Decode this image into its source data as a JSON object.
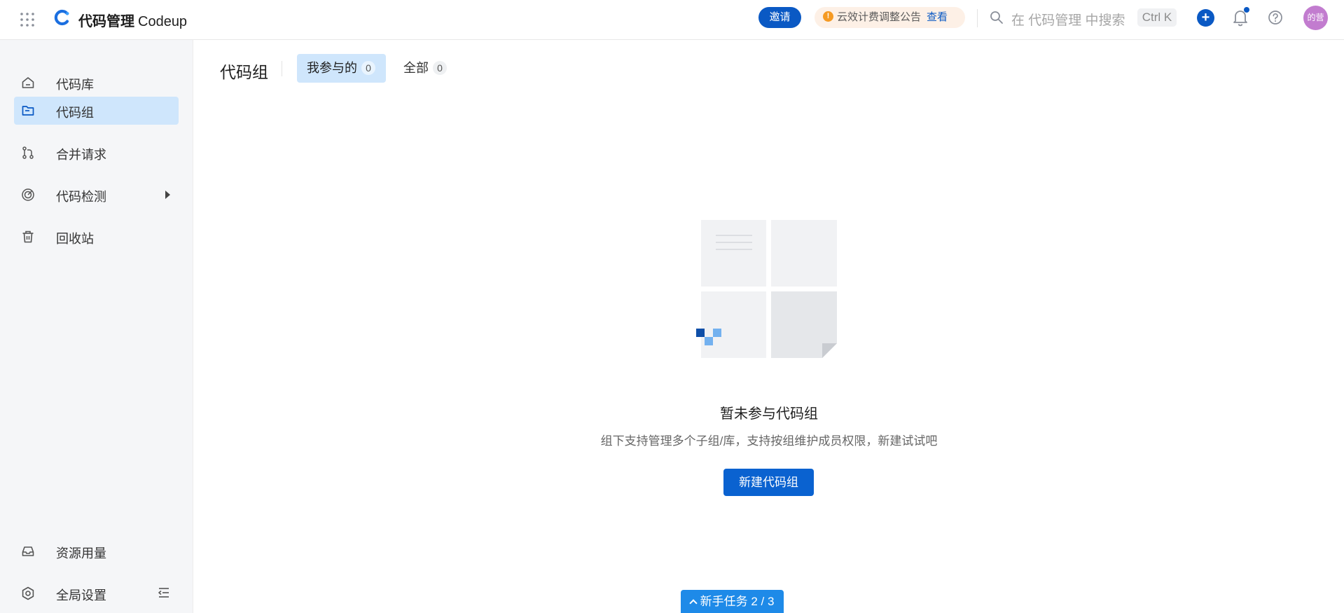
{
  "header": {
    "app_name": "代码管理",
    "app_name_en": "Codeup",
    "invite_label": "邀请",
    "notice_icon_text": "!",
    "notice_text": "云效计费调整公告",
    "notice_link": "查看",
    "search_placeholder": "在 代码管理 中搜索",
    "shortcut": "Ctrl K",
    "create_symbol": "+",
    "avatar_text": "的营"
  },
  "sidebar": {
    "items": [
      {
        "label": "代码库",
        "icon": "home-icon",
        "active": false
      },
      {
        "label": "代码组",
        "icon": "folder-icon",
        "active": true
      },
      {
        "label": "合并请求",
        "icon": "merge-icon",
        "active": false
      },
      {
        "label": "代码检测",
        "icon": "scan-icon",
        "active": false,
        "has_caret": true
      },
      {
        "label": "回收站",
        "icon": "trash-icon",
        "active": false
      }
    ],
    "bottom_items": [
      {
        "label": "资源用量",
        "icon": "inbox-icon"
      },
      {
        "label": "全局设置",
        "icon": "settings-icon"
      }
    ]
  },
  "main": {
    "title": "代码组",
    "tabs": [
      {
        "label": "我参与的",
        "count": "0",
        "active": true
      },
      {
        "label": "全部",
        "count": "0",
        "active": false
      }
    ],
    "empty": {
      "title": "暂未参与代码组",
      "description": "组下支持管理多个子组/库，支持按组维护成员权限，新建试试吧",
      "button": "新建代码组"
    },
    "task_button": "新手任务 2 / 3"
  },
  "colors": {
    "brand": "#0a59c4",
    "active_bg": "#cfe6fc",
    "sidebar_bg": "#f5f6f8",
    "notice_bg": "#fdf0e6",
    "avatar_bg": "#c27ccf"
  }
}
